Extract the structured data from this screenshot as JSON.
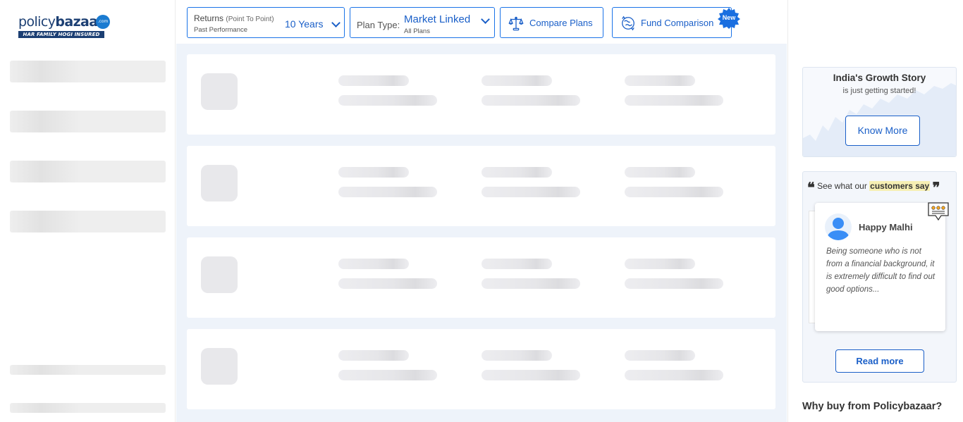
{
  "brand": {
    "logo_text_light": "policy",
    "logo_text_bold": "bazaar",
    "logo_badge": ".com",
    "tagline": "HAR FAMILY HOGI INSURED",
    "accent": "#1a73e8",
    "navy": "#1c3f73"
  },
  "toolbar": {
    "returns": {
      "label": "Returns",
      "label_qualifier": "(Point To Point)",
      "sublabel": "Past Performance",
      "value": "10 Years"
    },
    "plan_type": {
      "label": "Plan Type:",
      "value": "Market Linked",
      "sublabel": "All Plans"
    },
    "compare_label": "Compare Plans",
    "fund_label": "Fund Comparison",
    "new_badge": "New",
    "icons": [
      "scale-icon",
      "globe-exchange-icon",
      "chevron-down-icon"
    ]
  },
  "main": {
    "loading_cards": 4
  },
  "growth_card": {
    "title": "India's Growth Story",
    "subtitle": "is just getting started!",
    "button_label": "Know More"
  },
  "reviews": {
    "heading_prefix": "See what our",
    "heading_highlight": "customers say",
    "open_quote": "❝",
    "close_quote": "❞",
    "reviewer_name": "Happy Malhi",
    "review_text": "Being someone who is not from a financial background, it is extremely difficult to find out good options...",
    "read_more_label": "Read more"
  },
  "why_heading": "Why buy from Policybazaar?"
}
